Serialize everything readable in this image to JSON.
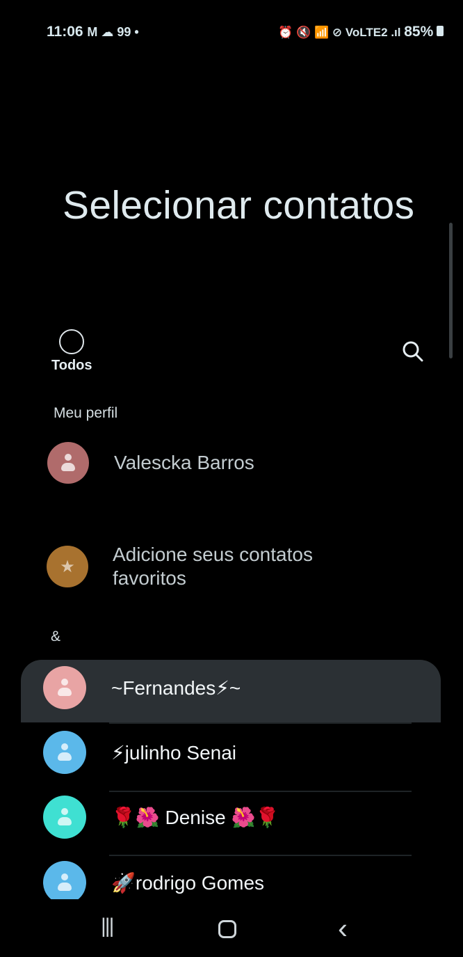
{
  "status_bar": {
    "time": "11:06",
    "left_icons": "M ☁ 99 •",
    "right_icons": "⏰ 🔇 📶 ⊘ VoLTE2 .ıl",
    "battery": "85%"
  },
  "title": "Selecionar contatos",
  "select_all": {
    "label": "Todos"
  },
  "my_profile": {
    "header": "Meu perfil",
    "name": "Valescka Barros"
  },
  "favorites": {
    "line1": "Adicione seus contatos",
    "line2": "favoritos"
  },
  "group_header": "&",
  "contacts": [
    {
      "name": "~Fernandes⚡~",
      "color": "#e8a4a4"
    },
    {
      "name": "⚡julinho Senai",
      "color": "#5bb8ea"
    },
    {
      "name": "🌹🌺 Denise 🌺🌹",
      "color": "#3fe0d2"
    },
    {
      "name": "🚀rodrigo Gomes",
      "color": "#5bb8ea"
    }
  ],
  "nav": {
    "recents": "|||",
    "home": "○",
    "back": "‹"
  }
}
